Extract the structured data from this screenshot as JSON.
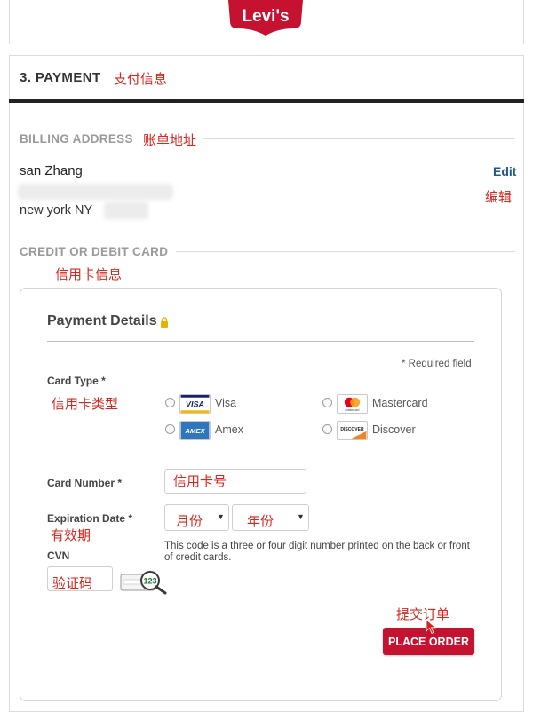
{
  "header": {
    "brand": "Levi's",
    "registered_mark": "®"
  },
  "section": {
    "title": "3. PAYMENT",
    "title_cn": "支付信息"
  },
  "billing": {
    "heading": "BILLING ADDRESS",
    "heading_cn": "账单地址",
    "name": "san Zhang",
    "city_line": "new york NY",
    "edit_label": "Edit",
    "edit_cn": "编辑"
  },
  "credit": {
    "heading": "CREDIT OR DEBIT CARD",
    "heading_cn": "信用卡信息"
  },
  "payment_details": {
    "title": "Payment Details",
    "required_note": "* Required field",
    "card_type_label": "Card Type *",
    "card_type_cn": "信用卡类型",
    "card_types": [
      {
        "name": "Visa",
        "logo_text": "VISA"
      },
      {
        "name": "Mastercard",
        "logo_text": "mastercard"
      },
      {
        "name": "Amex",
        "logo_text": "AMEX"
      },
      {
        "name": "Discover",
        "logo_text": "DISCOVER"
      }
    ],
    "card_number_label": "Card Number *",
    "card_number_cn": "信用卡号",
    "expiration_label": "Expiration Date *",
    "expiration_cn": "有效期",
    "month_cn": "月份",
    "year_cn": "年份",
    "cvn_help": "This code is a three or four digit number printed on the back or front of credit cards.",
    "cvn_label": "CVN",
    "cvn_cn": "验证码",
    "cvn_icon_digits": "123",
    "submit_cn": "提交订单",
    "place_order_label": "PLACE ORDER"
  },
  "colors": {
    "brand_red": "#c41230",
    "annotation_red": "#d9251d",
    "link_blue": "#1f5a8a",
    "lock_yellow": "#e8b400"
  }
}
